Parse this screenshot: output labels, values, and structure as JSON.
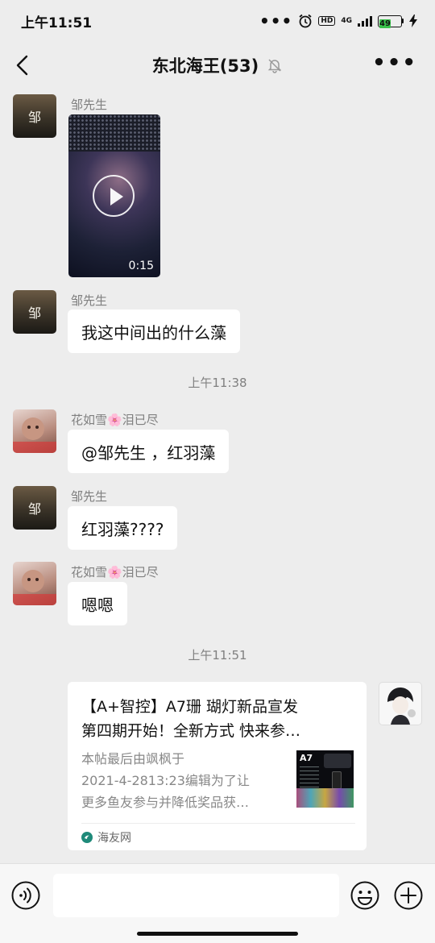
{
  "status_bar": {
    "time": "上午11:51",
    "network": "4G",
    "hd": "HD",
    "battery": "49"
  },
  "header": {
    "title": "东北海王(53)",
    "icons": {
      "back": "back-arrow-icon",
      "mute": "bell-muted-icon",
      "more": "more-icon"
    }
  },
  "messages": [
    {
      "sender": "邹先生",
      "avatar_text": "邹",
      "type": "video",
      "duration": "0:15"
    },
    {
      "sender": "邹先生",
      "avatar_text": "邹",
      "type": "text",
      "text": "我这中间出的什么藻"
    },
    {
      "type": "timestamp",
      "text": "上午11:38"
    },
    {
      "sender": "花如雪🌸泪已尽",
      "type": "text",
      "text": "@邹先生 ，红羽藻"
    },
    {
      "sender": "邹先生",
      "avatar_text": "邹",
      "type": "text",
      "text": "红羽藻????"
    },
    {
      "sender": "花如雪🌸泪已尽",
      "type": "text",
      "text": "嗯嗯"
    },
    {
      "type": "timestamp",
      "text": "上午11:51"
    }
  ],
  "link_card": {
    "title_line1": "【A+智控】A7珊 瑚灯新品宣发",
    "title_line2": "第四期开始！全新方式  快来参…",
    "desc_line1": "本帖最后由飒枫于",
    "desc_line2": "2021-4-2813:23编辑为了让",
    "desc_line3": "更多鱼友参与并降低奖品获…",
    "thumb_text": "A7",
    "source": "海友网"
  },
  "input_bar": {
    "placeholder": "",
    "icons": {
      "voice": "voice-icon",
      "emoji": "emoji-icon",
      "plus": "plus-icon"
    }
  },
  "colors": {
    "background": "#ededed",
    "bubble": "#ffffff",
    "battery": "#39c24a"
  }
}
